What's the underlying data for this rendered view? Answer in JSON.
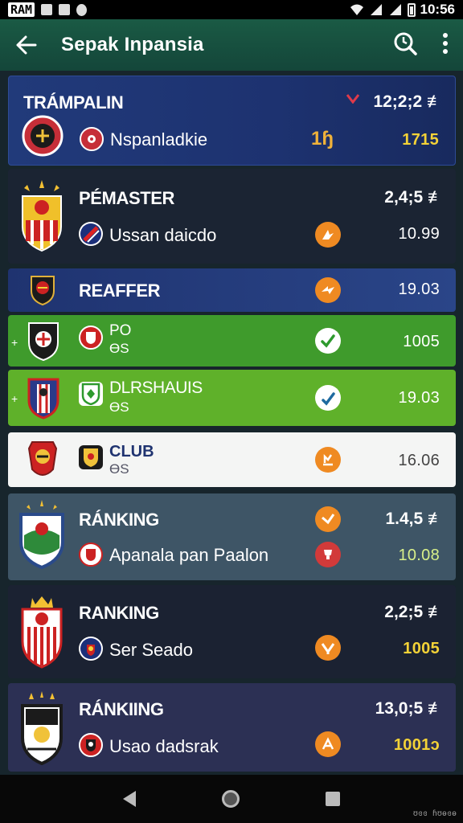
{
  "status_bar": {
    "carrier": "RAM",
    "time": "10:56"
  },
  "app_bar": {
    "title": "Sepak Inpansia"
  },
  "rows": [
    {
      "title": "TRÁMPALIN",
      "value": "12;2;2 ≢",
      "team": "Nspanladkie",
      "mid": "1ɧ",
      "score": "1715"
    },
    {
      "title": "PÉMASTER",
      "value": "2,4;5 ≢",
      "team": "Ussan daicdo",
      "score": "10.99"
    },
    {
      "title": "REAFFER",
      "score": "19.03"
    },
    {
      "title": "PO",
      "subtitle": "ƟS",
      "score": "1005"
    },
    {
      "title": "DLRSHAUIS",
      "subtitle": "ƟS",
      "score": "19.03"
    },
    {
      "title": "CLUB",
      "subtitle": "ƟS",
      "score": "16.06"
    },
    {
      "title": "RÁNKING",
      "value": "1.4,5 ≢",
      "team": "Apanala pan Paalon",
      "score": "10.08"
    },
    {
      "title": "RANKING",
      "value": "2,2;5 ≢",
      "team": "Ser Seado",
      "score": "1005"
    },
    {
      "title": "RÁNKIING",
      "value": "13,0;5 ≢",
      "team": "Usao dadsrak",
      "score": "1001ɔ"
    }
  ],
  "watermark": "ʊɞɞ ɦʊɵɞɵ",
  "colors": {
    "appbar": "#1a5a44",
    "row_blue": "#1f3370",
    "row_dark": "#1b2433",
    "row_green": "#3f9b2c",
    "row_lime": "#5fb12a",
    "row_white": "#f4f5f4",
    "row_slate": "#3e5566",
    "accent_yellow": "#f3d237",
    "badge_orange": "#ef8a22",
    "badge_red": "#d23a3a"
  }
}
